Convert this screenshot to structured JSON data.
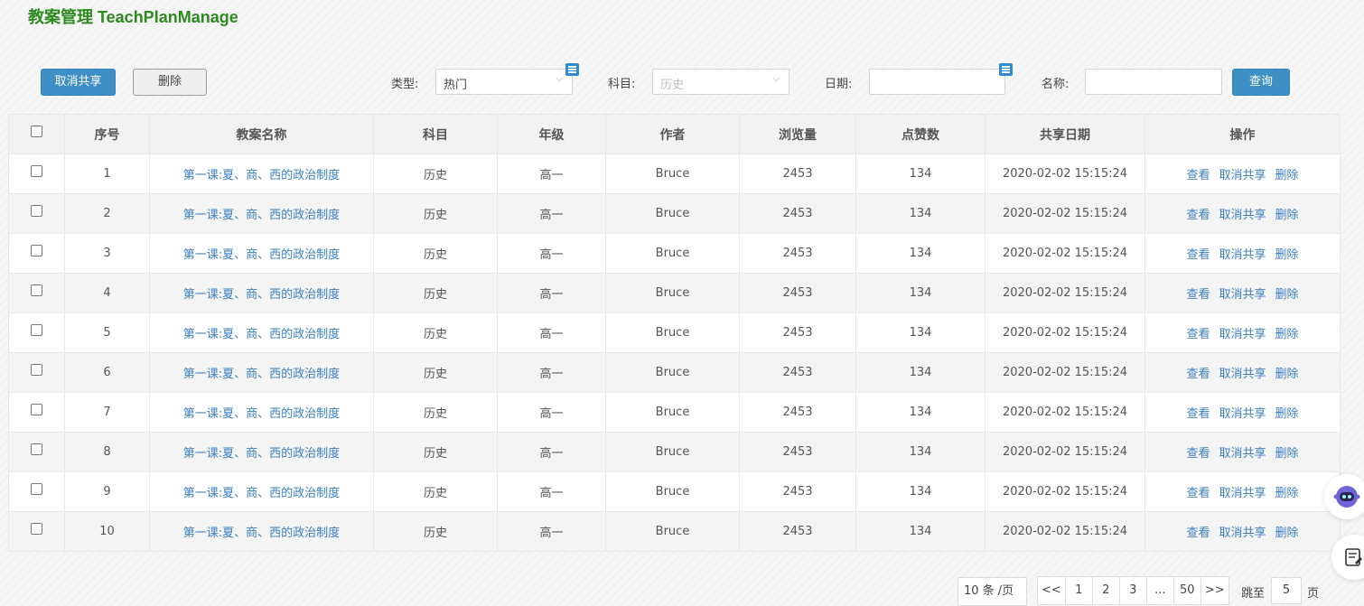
{
  "header": {
    "title": "教案管理 TeachPlanManage"
  },
  "toolbar": {
    "unshare_label": "取消共享",
    "delete_label": "删除"
  },
  "filters": {
    "type_label": "类型:",
    "type_value": "热门",
    "subject_label": "科目:",
    "subject_value": "历史",
    "date_label": "日期:",
    "date_value": "",
    "name_label": "名称:",
    "name_value": "",
    "query_label": "查询"
  },
  "table": {
    "headers": [
      "序号",
      "教案名称",
      "科目",
      "年级",
      "作者",
      "浏览量",
      "点赞数",
      "共享日期",
      "操作"
    ],
    "actions": [
      "查看",
      "取消共享",
      "删除"
    ],
    "rows": [
      {
        "no": "1",
        "name": "第一课:夏、商、西的政治制度",
        "subject": "历史",
        "grade": "高一",
        "author": "Bruce",
        "views": "2453",
        "likes": "134",
        "date": "2020-02-02 15:15:24"
      },
      {
        "no": "2",
        "name": "第一课:夏、商、西的政治制度",
        "subject": "历史",
        "grade": "高一",
        "author": "Bruce",
        "views": "2453",
        "likes": "134",
        "date": "2020-02-02 15:15:24"
      },
      {
        "no": "3",
        "name": "第一课:夏、商、西的政治制度",
        "subject": "历史",
        "grade": "高一",
        "author": "Bruce",
        "views": "2453",
        "likes": "134",
        "date": "2020-02-02 15:15:24"
      },
      {
        "no": "4",
        "name": "第一课:夏、商、西的政治制度",
        "subject": "历史",
        "grade": "高一",
        "author": "Bruce",
        "views": "2453",
        "likes": "134",
        "date": "2020-02-02 15:15:24"
      },
      {
        "no": "5",
        "name": "第一课:夏、商、西的政治制度",
        "subject": "历史",
        "grade": "高一",
        "author": "Bruce",
        "views": "2453",
        "likes": "134",
        "date": "2020-02-02 15:15:24"
      },
      {
        "no": "6",
        "name": "第一课:夏、商、西的政治制度",
        "subject": "历史",
        "grade": "高一",
        "author": "Bruce",
        "views": "2453",
        "likes": "134",
        "date": "2020-02-02 15:15:24"
      },
      {
        "no": "7",
        "name": "第一课:夏、商、西的政治制度",
        "subject": "历史",
        "grade": "高一",
        "author": "Bruce",
        "views": "2453",
        "likes": "134",
        "date": "2020-02-02 15:15:24"
      },
      {
        "no": "8",
        "name": "第一课:夏、商、西的政治制度",
        "subject": "历史",
        "grade": "高一",
        "author": "Bruce",
        "views": "2453",
        "likes": "134",
        "date": "2020-02-02 15:15:24"
      },
      {
        "no": "9",
        "name": "第一课:夏、商、西的政治制度",
        "subject": "历史",
        "grade": "高一",
        "author": "Bruce",
        "views": "2453",
        "likes": "134",
        "date": "2020-02-02 15:15:24"
      },
      {
        "no": "10",
        "name": "第一课:夏、商、西的政治制度",
        "subject": "历史",
        "grade": "高一",
        "author": "Bruce",
        "views": "2453",
        "likes": "134",
        "date": "2020-02-02 15:15:24"
      }
    ]
  },
  "pagination": {
    "page_size": "10 条 /页",
    "first": "<<",
    "pages": [
      "1",
      "2",
      "3",
      "...",
      "50"
    ],
    "last": ">>",
    "jump_label": "跳至",
    "jump_value": "5",
    "page_suffix": "页"
  },
  "icons": {
    "calendar": "calendar-icon",
    "chevron": "chevron-down-icon",
    "robot": "robot-assistant-icon",
    "notes": "notes-icon"
  },
  "colors": {
    "title": "#2c8a1f",
    "primary": "#3d8fc6",
    "link": "#3a7fc0"
  }
}
